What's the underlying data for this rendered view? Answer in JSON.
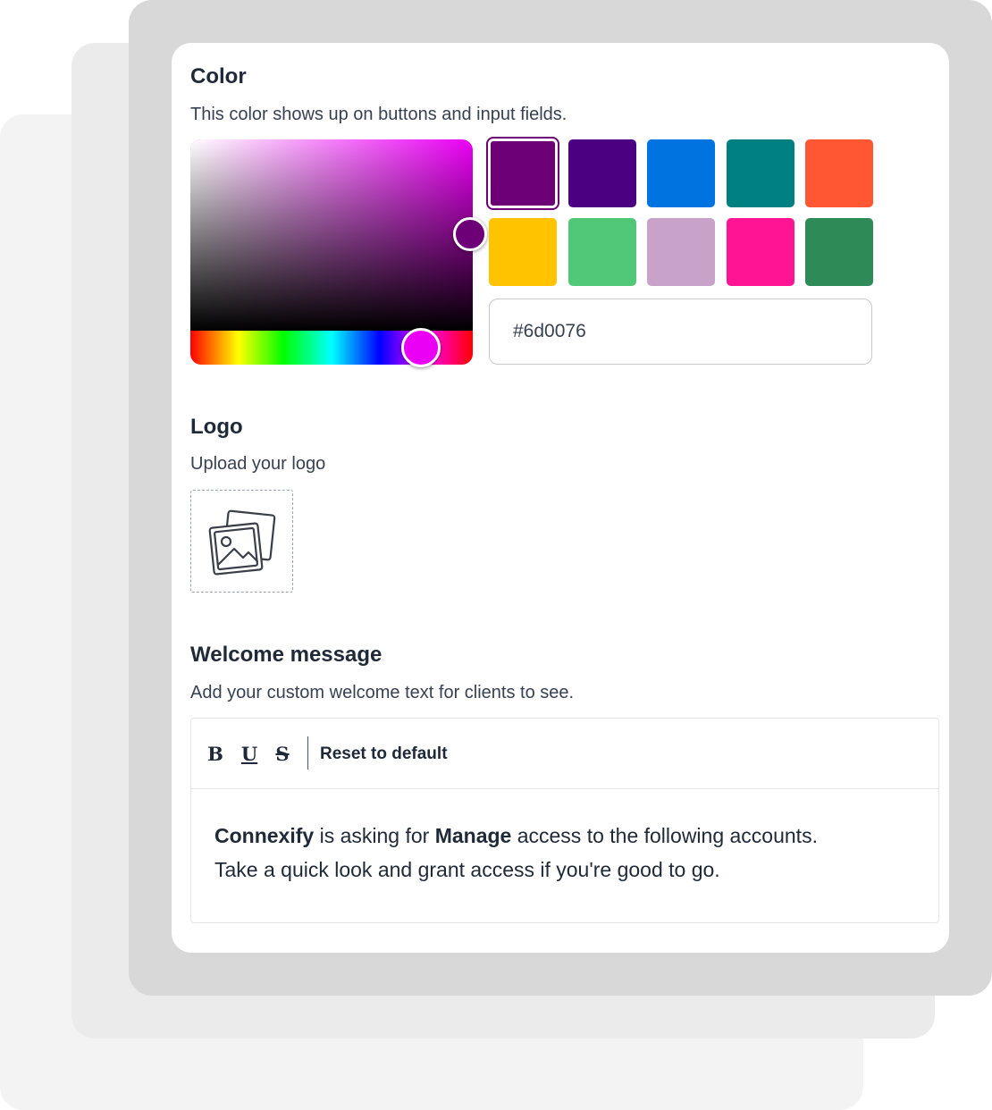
{
  "color_section": {
    "title": "Color",
    "description": "This color shows up on buttons and input fields.",
    "hex_value": "#6d0076",
    "hue_color": "#ea00f4",
    "swatches": [
      {
        "name": "swatch-purple",
        "color": "#6d0076",
        "selected": true
      },
      {
        "name": "swatch-indigo",
        "color": "#4b0082",
        "selected": false
      },
      {
        "name": "swatch-blue",
        "color": "#0073e0",
        "selected": false
      },
      {
        "name": "swatch-teal",
        "color": "#008080",
        "selected": false
      },
      {
        "name": "swatch-orange",
        "color": "#ff5733",
        "selected": false
      },
      {
        "name": "swatch-yellow",
        "color": "#ffc300",
        "selected": false
      },
      {
        "name": "swatch-green",
        "color": "#50c878",
        "selected": false
      },
      {
        "name": "swatch-lilac",
        "color": "#c8a2c8",
        "selected": false
      },
      {
        "name": "swatch-pink",
        "color": "#ff1493",
        "selected": false
      },
      {
        "name": "swatch-dark-green",
        "color": "#2e8b57",
        "selected": false
      }
    ]
  },
  "logo_section": {
    "title": "Logo",
    "description": "Upload your logo",
    "upload_icon": "image-gallery-icon"
  },
  "welcome_section": {
    "title": "Welcome message",
    "description": "Add your custom welcome text for clients to see.",
    "toolbar": {
      "bold_label": "B",
      "underline_label": "U",
      "strike_label": "S",
      "reset_label": "Reset to default"
    },
    "message": {
      "company": "Connexify",
      "part1": " is asking for ",
      "access_level": "Manage",
      "part2": " access to the following accounts.",
      "line2": "Take a quick look and grant access if you're good to go."
    }
  }
}
